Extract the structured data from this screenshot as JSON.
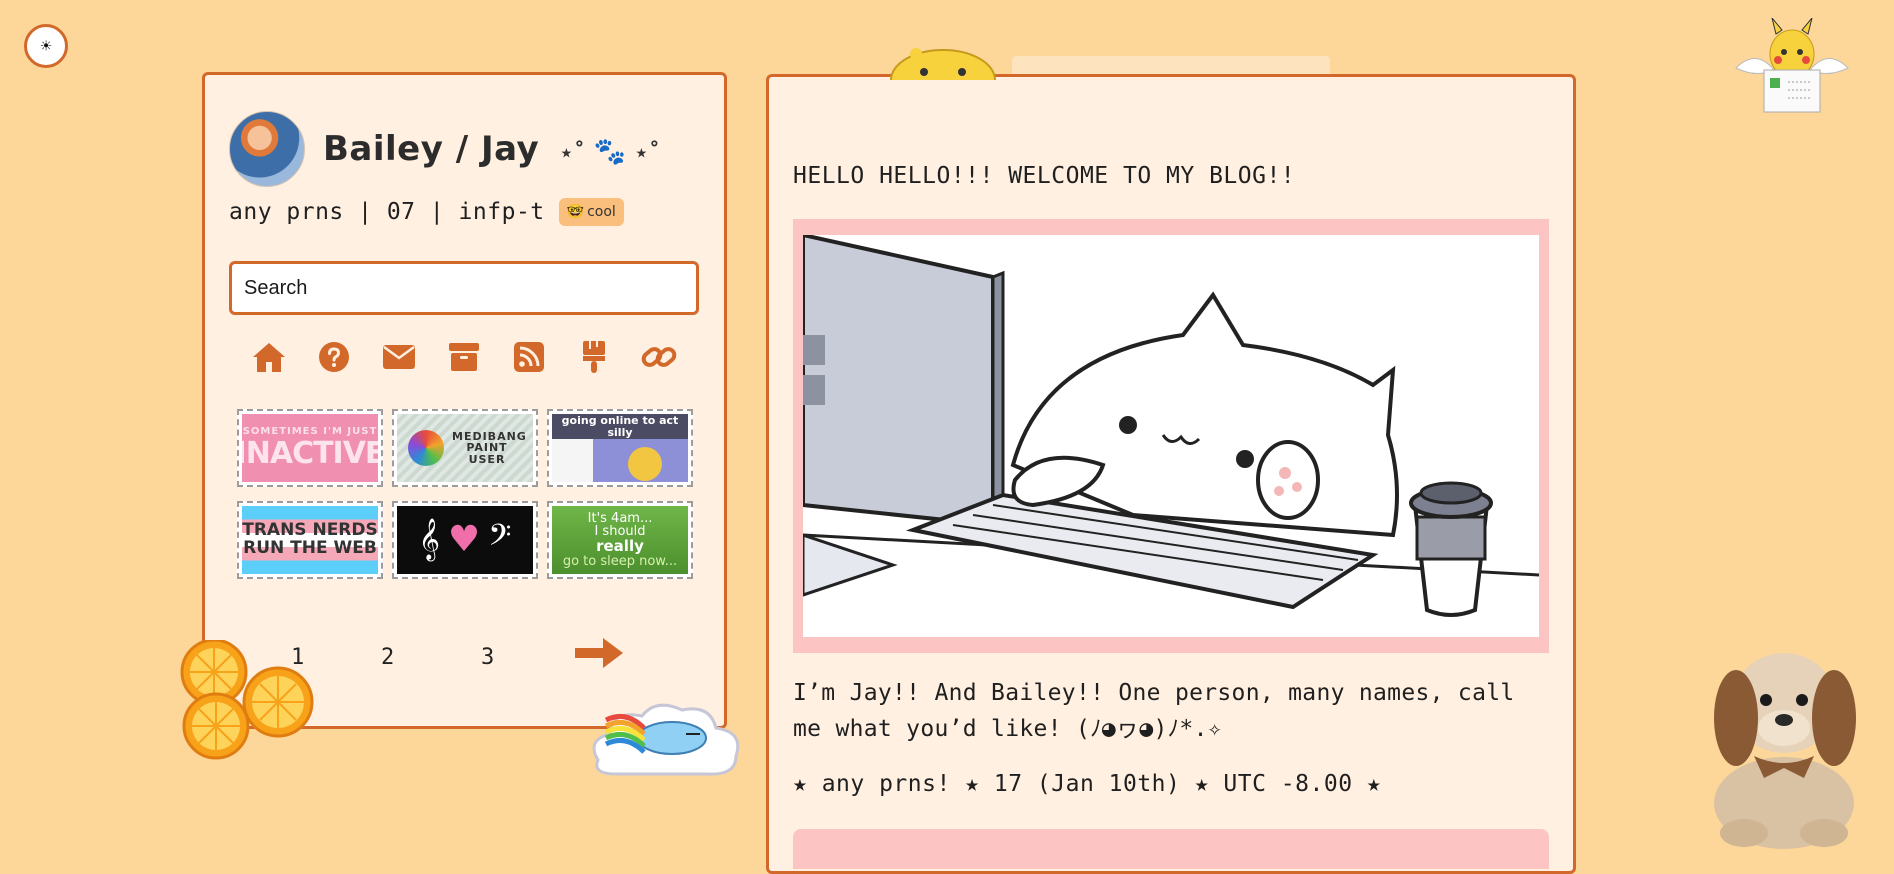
{
  "theme_toggle": {
    "icon": "sun-icon",
    "glyph": "☀"
  },
  "profile": {
    "name": "Bailey / Jay",
    "name_decor_left": "⋆˚",
    "name_decor_right": "⋆˚",
    "info": "any prns | 07 | infp-t",
    "badge_label": "cool",
    "badge_icon": "nerd-face-icon",
    "badge_glyph": "🤓"
  },
  "search": {
    "placeholder": "Search",
    "value": ""
  },
  "nav": {
    "items": [
      {
        "icon": "home-icon"
      },
      {
        "icon": "question-circle-icon"
      },
      {
        "icon": "envelope-icon"
      },
      {
        "icon": "archive-box-icon"
      },
      {
        "icon": "rss-icon"
      },
      {
        "icon": "paintbrush-icon"
      },
      {
        "icon": "link-icon"
      }
    ]
  },
  "stamps": [
    {
      "line1": "SOMETIMES I'M JUST",
      "line2": "INACTIVE"
    },
    {
      "text": "MEDIBANG PAINT USER"
    },
    {
      "text": "going online to act silly"
    },
    {
      "line1": "TRANS NERDS",
      "line2": "RUN THE WEB"
    },
    {
      "text": "♪ ♥ ♫"
    },
    {
      "line1": "It's 4am...",
      "line2": "I should",
      "line3": "really",
      "line4": "go to sleep now..."
    }
  ],
  "pagination": {
    "pages": [
      "1",
      "2",
      "3"
    ],
    "next_icon": "arrow-right-icon"
  },
  "blog": {
    "heading": "HELLO HELLO!!! WELCOME TO MY BLOG!!",
    "intro": "I’m Jay!! And Bailey!! One person, many names, call me what you’d like! (ﾉ◕ヮ◕)ﾉ*.✧",
    "stats": "★ any prns! ★ 17 (Jan 10th) ★ UTC -8.00 ★"
  },
  "colors": {
    "background": "#fdd79a",
    "panel": "#fff0e1",
    "accent": "#d2692a",
    "hero_frame": "#fdc4c4",
    "badge": "#fbbf7d"
  }
}
